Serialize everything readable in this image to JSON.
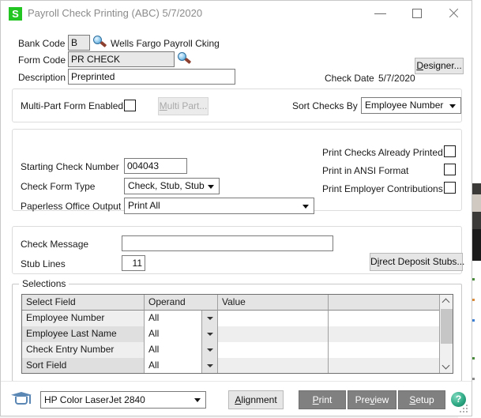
{
  "window": {
    "logo_letter": "S",
    "title": "Payroll Check Printing (ABC) 5/7/2020",
    "minimize": "minimize-icon",
    "maximize": "maximize-icon",
    "close": "close-icon"
  },
  "header": {
    "bank_code_label": "Bank Code",
    "bank_code_value": "B",
    "bank_name": "Wells Fargo Payroll Cking",
    "form_code_label": "Form Code",
    "form_code_value": "PR CHECK",
    "description_label": "Description",
    "description_value": "Preprinted",
    "designer_button": "Designer...",
    "check_date_label": "Check Date",
    "check_date_value": "5/7/2020"
  },
  "multipart": {
    "enabled_label": "Multi-Part Form Enabled",
    "enabled_checked": false,
    "multi_part_button": "Multi Part...",
    "multi_part_disabled": true,
    "sort_checks_label": "Sort Checks By",
    "sort_checks_value": "Employee Number"
  },
  "options": {
    "starting_check_number_label": "Starting Check Number",
    "starting_check_number_value": "004043",
    "check_form_type_label": "Check Form Type",
    "check_form_type_value": "Check, Stub, Stub",
    "paperless_label": "Paperless Office Output",
    "paperless_value": "Print All",
    "checkboxes": [
      {
        "label": "Print Checks Already Printed",
        "checked": false
      },
      {
        "label": "Print in ANSI Format",
        "checked": false
      },
      {
        "label": "Print Employer Contributions",
        "checked": false
      }
    ]
  },
  "message": {
    "check_message_label": "Check Message",
    "check_message_value": "",
    "stub_lines_label": "Stub Lines",
    "stub_lines_value": "11",
    "direct_deposit_button": "Direct Deposit Stubs..."
  },
  "selections": {
    "group_title": "Selections",
    "columns": [
      "Select Field",
      "Operand",
      "Value",
      ""
    ],
    "rows": [
      {
        "field": "Employee Number",
        "operand": "All",
        "value": "",
        "value2": ""
      },
      {
        "field": "Employee Last Name",
        "operand": "All",
        "value": "",
        "value2": ""
      },
      {
        "field": "Check Entry Number",
        "operand": "All",
        "value": "",
        "value2": ""
      },
      {
        "field": "Sort Field",
        "operand": "All",
        "value": "",
        "value2": ""
      }
    ]
  },
  "footer": {
    "printer_icon": "graduation-cap-icon",
    "printer_value": "HP Color LaserJet 2840",
    "alignment_button": "Alignment",
    "print_button": "Print",
    "preview_button": "Preview",
    "setup_button": "Setup",
    "help_glyph": "?"
  },
  "colors": {
    "logo_green": "#22c522",
    "dark_button": "#808080",
    "help_green": "#2faa84",
    "icon_blue": "#5b87b5"
  }
}
